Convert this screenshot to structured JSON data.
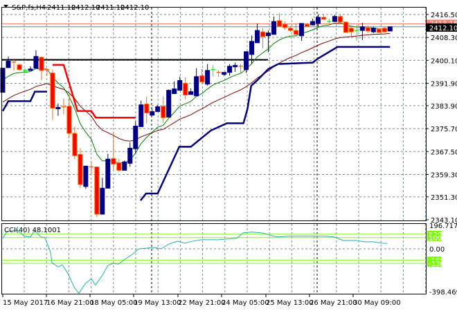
{
  "header": {
    "symbol_label": "S&P,fs,H4",
    "ohlc": [
      "2411.10",
      "2412.10",
      "2411.10",
      "2412.10"
    ]
  },
  "price_axis": {
    "labels": [
      "2416.50",
      "2408.30",
      "2400.10",
      "2391.90",
      "2383.90",
      "2375.70",
      "2367.50",
      "2359.30",
      "2351.30",
      "2343.10"
    ],
    "current_price_label": "2412.10",
    "ask_price_label": "2413.15",
    "range": [
      2343.1,
      2416.5
    ]
  },
  "time_axis": {
    "labels": [
      "15 May 2017",
      "16 May 21:00",
      "18 May 05:00",
      "19 May 13:00",
      "22 May 21:00",
      "24 May 05:00",
      "25 May 13:00",
      "26 May 21:00",
      "30 May 09:00"
    ]
  },
  "indicator": {
    "label": "CCI(40) 48.1001",
    "axis_top": "196.7175",
    "axis_zero": "0.00",
    "axis_bottom": "-398.469",
    "levels": [
      "130",
      "100",
      "-100",
      "-130"
    ],
    "range": [
      -398.469,
      196.7175
    ],
    "points": [
      [
        0,
        93
      ],
      [
        0.75,
        155
      ],
      [
        2.6,
        167
      ],
      [
        3.9,
        112
      ],
      [
        5,
        105
      ],
      [
        5.75,
        161
      ],
      [
        6.9,
        105
      ],
      [
        7.6,
        99
      ],
      [
        8.6,
        -25
      ],
      [
        8.9,
        -124
      ],
      [
        10,
        -161
      ],
      [
        10.75,
        -143
      ],
      [
        11.75,
        -217
      ],
      [
        12.9,
        -341
      ],
      [
        13.75,
        -397
      ],
      [
        14.9,
        -310
      ],
      [
        16,
        -267
      ],
      [
        16.75,
        -323
      ],
      [
        18,
        -236
      ],
      [
        19,
        -149
      ],
      [
        19.9,
        -130
      ],
      [
        20.9,
        -136
      ],
      [
        22.1,
        -93
      ],
      [
        23.4,
        -50
      ],
      [
        24.6,
        0
      ],
      [
        26.1,
        6
      ],
      [
        27.4,
        12
      ],
      [
        28.6,
        0
      ],
      [
        30.1,
        43
      ],
      [
        31.6,
        68
      ],
      [
        32.9,
        50
      ],
      [
        34.4,
        68
      ],
      [
        35.9,
        81
      ],
      [
        37.5,
        81
      ],
      [
        39,
        81
      ],
      [
        40.4,
        87
      ],
      [
        42.25,
        93
      ],
      [
        43.5,
        143
      ],
      [
        45,
        149
      ],
      [
        46.6,
        143
      ],
      [
        47.75,
        130
      ],
      [
        48.9,
        112
      ],
      [
        49.75,
        105
      ],
      [
        51.75,
        112
      ],
      [
        56.25,
        112
      ],
      [
        58.25,
        112
      ],
      [
        59.9,
        105
      ],
      [
        61.5,
        74
      ],
      [
        63.9,
        74
      ],
      [
        65.4,
        62
      ],
      [
        67,
        62
      ],
      [
        68.5,
        50
      ],
      [
        69.5,
        48.1
      ]
    ]
  },
  "horizontal_level": 2400.3,
  "colors": {
    "bull": "#000080",
    "bear": "#ff0000",
    "bear_border": "#ff6a00",
    "doji_green": "#00ff00",
    "ma_fast": "#008000",
    "ma_slow": "#800000",
    "trail_blue": "#000080",
    "trail_red": "#ff0000",
    "level_green": "#7cfc00",
    "cci": "#20b2aa",
    "grid": "#778899"
  },
  "candles": [
    [
      2388.7,
      2397.3,
      2388.7,
      2397.3
    ],
    [
      2397.5,
      2401.5,
      2397.5,
      2399.8
    ],
    [
      2399.5,
      2400.3,
      2396.5,
      2399.5
    ],
    [
      2398.5,
      2399,
      2396.5,
      2396.8
    ],
    [
      2396.5,
      2397.3,
      2395.5,
      2396.5
    ],
    [
      2396.5,
      2398,
      2396.5,
      2397
    ],
    [
      2397.3,
      2403.7,
      2397.3,
      2401.5
    ],
    [
      2401.2,
      2401.5,
      2393,
      2396.5
    ],
    [
      2396.8,
      2397.3,
      2394.8,
      2396.8
    ],
    [
      2395.6,
      2396.8,
      2378.8,
      2383
    ],
    [
      2382.8,
      2384.7,
      2380.3,
      2383.3
    ],
    [
      2383.5,
      2386.5,
      2380.8,
      2383.7
    ],
    [
      2383.7,
      2388,
      2372.7,
      2374
    ],
    [
      2374,
      2376.4,
      2364.8,
      2366
    ],
    [
      2366.5,
      2368.7,
      2354.4,
      2355.7
    ],
    [
      2355,
      2362.3,
      2354.2,
      2362.3
    ],
    [
      2362,
      2364,
      2359.2,
      2362
    ],
    [
      2362,
      2362,
      2344.1,
      2345.1
    ],
    [
      2345.1,
      2358.1,
      2345.1,
      2354.4
    ],
    [
      2354.4,
      2366.7,
      2354.4,
      2364.8
    ],
    [
      2365,
      2374.6,
      2361.1,
      2363
    ],
    [
      2363.5,
      2364.8,
      2360.3,
      2360.8
    ],
    [
      2360.8,
      2364.3,
      2360.8,
      2363.8
    ],
    [
      2363.3,
      2370.7,
      2362.1,
      2368.7
    ],
    [
      2368.5,
      2378.3,
      2367,
      2376.6
    ],
    [
      2376.4,
      2385.7,
      2376.4,
      2384.2
    ],
    [
      2384.5,
      2387.2,
      2377.6,
      2381.3
    ],
    [
      2380.5,
      2382.8,
      2380.5,
      2381.8
    ],
    [
      2381.8,
      2384.2,
      2381.8,
      2383.5
    ],
    [
      2383.7,
      2387.2,
      2377.8,
      2379.6
    ],
    [
      2379.8,
      2389.7,
      2379.8,
      2389.4
    ],
    [
      2388.2,
      2392.6,
      2388.2,
      2389.9
    ],
    [
      2389.4,
      2394.3,
      2389.4,
      2392.9
    ],
    [
      2391.9,
      2394.1,
      2386.2,
      2387.7
    ],
    [
      2387.9,
      2390.1,
      2387.9,
      2388.9
    ],
    [
      2387.4,
      2397.3,
      2387.4,
      2394.3
    ],
    [
      2394.6,
      2397,
      2391.9,
      2392.4
    ],
    [
      2391.6,
      2398.8,
      2391.1,
      2396.5
    ],
    [
      2396.8,
      2398.3,
      2394.3,
      2396.8
    ],
    [
      2395.8,
      2396.5,
      2394.1,
      2395.8
    ],
    [
      2395.1,
      2395.8,
      2394.6,
      2395.8
    ],
    [
      2395.8,
      2398.8,
      2394.6,
      2398
    ],
    [
      2397.8,
      2399.3,
      2396,
      2398.3
    ],
    [
      2398,
      2398.8,
      2395.3,
      2398
    ],
    [
      2396.8,
      2403.2,
      2395.6,
      2403.2
    ],
    [
      2402.2,
      2409,
      2398.8,
      2406.9
    ],
    [
      2406.4,
      2413.3,
      2406.4,
      2410.8
    ],
    [
      2410.3,
      2411.6,
      2404.4,
      2408.6
    ],
    [
      2408.9,
      2410.8,
      2403,
      2409.9
    ],
    [
      2409.4,
      2415.8,
      2409.4,
      2414
    ],
    [
      2414.3,
      2417,
      2412,
      2412.3
    ],
    [
      2413,
      2414,
      2411,
      2411.8
    ],
    [
      2411.6,
      2412.3,
      2410.3,
      2410.8
    ],
    [
      2410.8,
      2413.3,
      2408.6,
      2409.4
    ],
    [
      2408.9,
      2413.3,
      2407.1,
      2413.3
    ],
    [
      2413,
      2413.5,
      2412,
      2412.3
    ],
    [
      2412.8,
      2415,
      2412.6,
      2414
    ],
    [
      2413.3,
      2416.5,
      2412,
      2415.5
    ],
    [
      2415.5,
      2416.5,
      2414.5,
      2414.8
    ],
    [
      2414,
      2415,
      2413,
      2414
    ],
    [
      2414,
      2416.3,
      2413.8,
      2415.8
    ],
    [
      2415.8,
      2416.5,
      2413.5,
      2413.8
    ],
    [
      2413.8,
      2414,
      2409.9,
      2410.1
    ],
    [
      2411.6,
      2412.3,
      2408.6,
      2410.3
    ],
    [
      2410.8,
      2412.8,
      2407.1,
      2410.8
    ],
    [
      2410.8,
      2413.5,
      2407.4,
      2412.1
    ],
    [
      2411.8,
      2412.6,
      2409.9,
      2410.6
    ],
    [
      2410.3,
      2412,
      2409.9,
      2411.6
    ],
    [
      2411.3,
      2411.6,
      2409.9,
      2410.1
    ],
    [
      2411.6,
      2412,
      2410.1,
      2410.3
    ],
    [
      2410.6,
      2412.1,
      2410.6,
      2412.1
    ]
  ],
  "trail_blue_segments": [
    [
      [
        0,
        2382
      ],
      [
        1,
        2385.5
      ],
      [
        5,
        2385.5
      ],
      [
        5.8,
        2388.9
      ],
      [
        8,
        2388.9
      ]
    ],
    [
      [
        24.9,
        2350
      ],
      [
        25.9,
        2352.5
      ],
      [
        28,
        2352.5
      ],
      [
        31.9,
        2369.2
      ],
      [
        34,
        2369.2
      ],
      [
        37.6,
        2375
      ],
      [
        40.5,
        2377.6
      ],
      [
        43.5,
        2377.6
      ],
      [
        44.2,
        2382.5
      ],
      [
        44.9,
        2391
      ],
      [
        46,
        2393
      ],
      [
        48,
        2397
      ],
      [
        49.8,
        2398.8
      ],
      [
        56,
        2399.3
      ],
      [
        57,
        2400.8
      ],
      [
        60.5,
        2404.9
      ],
      [
        70,
        2404.9
      ]
    ]
  ],
  "trail_red_segments": [
    [
      [
        9,
        2398.5
      ],
      [
        11,
        2398.5
      ],
      [
        13.5,
        2382
      ],
      [
        16,
        2382
      ],
      [
        16.8,
        2379.6
      ],
      [
        24,
        2379.6
      ]
    ]
  ]
}
